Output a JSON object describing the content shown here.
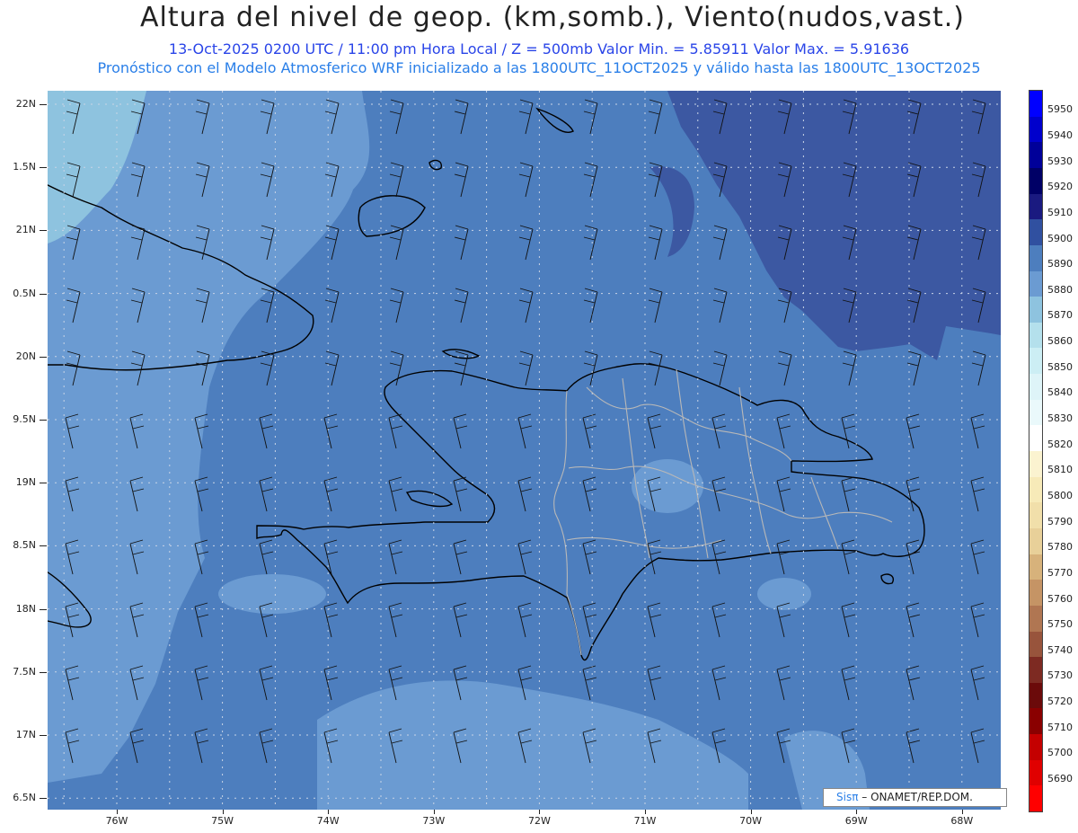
{
  "header": {
    "title": "Altura del nivel de geop. (km,somb.), Viento(nudos,vast.)",
    "subtitle": "13-Oct-2025  0200 UTC / 11:00 pm Hora Local / Z = 500mb    Valor Min. = 5.85911  Valor Max. = 5.91636",
    "forecast_note": "Pronóstico con el Modelo Atmosferico WRF inicializado a las 1800UTC_11OCT2025 y válido hasta las  1800UTC_13OCT2025"
  },
  "axes": {
    "lat_labels": [
      "22N",
      "1.5N",
      "21N",
      "0.5N",
      "20N",
      "9.5N",
      "19N",
      "8.5N",
      "18N",
      "7.5N",
      "17N",
      "6.5N"
    ],
    "lon_labels": [
      "76W",
      "75W",
      "74W",
      "73W",
      "72W",
      "71W",
      "70W",
      "69W",
      "68W"
    ]
  },
  "colorbar": {
    "labels": [
      "5950",
      "5940",
      "5930",
      "5920",
      "5910",
      "5900",
      "5890",
      "5880",
      "5870",
      "5860",
      "5850",
      "5840",
      "5830",
      "5820",
      "5810",
      "5800",
      "5790",
      "5780",
      "5770",
      "5760",
      "5750",
      "5740",
      "5730",
      "5720",
      "5710",
      "5700",
      "5690"
    ],
    "colors": [
      "#0000ff",
      "#0000cc",
      "#000099",
      "#000066",
      "#1a1a80",
      "#3050a0",
      "#4d7ebe",
      "#6b9bd2",
      "#8ec3df",
      "#b4e0ec",
      "#cceef4",
      "#def4f8",
      "#eaf9fb",
      "#ffffff",
      "#fbf3d0",
      "#f7eab8",
      "#f1dfaa",
      "#e8d099",
      "#d7b27b",
      "#c59465",
      "#b07652",
      "#98543c",
      "#7d2a22",
      "#6b0a0a",
      "#8a0000",
      "#c40000",
      "#e00000",
      "#ff0000"
    ]
  },
  "map": {
    "background_color": "#4d7ebe",
    "high_color": "#3c58a2",
    "light_color": "#6b9bd2",
    "lighter_color": "#8ec3df"
  },
  "credit": {
    "brand": "Sisπ",
    "text": " – ONAMET/REP.DOM."
  }
}
